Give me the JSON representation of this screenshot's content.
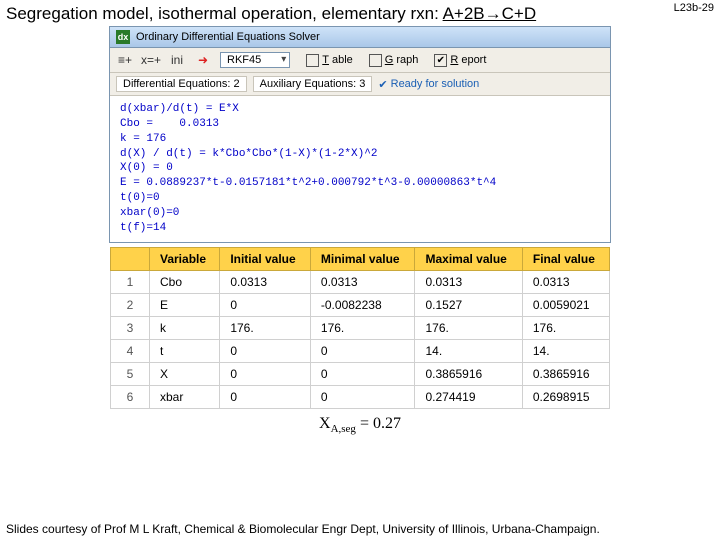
{
  "header": {
    "title_pre": "Segregation model, isothermal operation, elementary rxn: ",
    "title_rxn": "A+2B→C+D",
    "slide_no": "L23b-29"
  },
  "window": {
    "title": "Ordinary Differential Equations Solver"
  },
  "toolbar": {
    "method": "RKF45",
    "opt_table": "Table",
    "opt_graph": "Graph",
    "opt_report": "Report",
    "checked_report": "✔"
  },
  "status": {
    "de_label": "Differential Equations:",
    "de_n": "2",
    "aux_label": "Auxiliary Equations:",
    "aux_n": "3",
    "ready": "Ready for solution"
  },
  "equations": {
    "l1": "d(xbar)/d(t) = E*X",
    "l2": "Cbo =    0.0313",
    "l3": "k = 176",
    "l4": "d(X) / d(t) = k*Cbo*Cbo*(1-X)*(1-2*X)^2",
    "l5": "X(0) = 0",
    "l6": "E = 0.0889237*t-0.0157181*t^2+0.000792*t^3-0.00000863*t^4",
    "l7": "t(0)=0",
    "l8": "xbar(0)=0",
    "l9": "t(f)=14"
  },
  "table": {
    "cols": [
      "Variable",
      "Initial value",
      "Minimal value",
      "Maximal value",
      "Final value"
    ],
    "rows": [
      {
        "n": "1",
        "v": "Cbo",
        "a": "0.0313",
        "b": "0.0313",
        "c": "0.0313",
        "d": "0.0313"
      },
      {
        "n": "2",
        "v": "E",
        "a": "0",
        "b": "-0.0082238",
        "c": "0.1527",
        "d": "0.0059021"
      },
      {
        "n": "3",
        "v": "k",
        "a": "176.",
        "b": "176.",
        "c": "176.",
        "d": "176."
      },
      {
        "n": "4",
        "v": "t",
        "a": "0",
        "b": "0",
        "c": "14.",
        "d": "14."
      },
      {
        "n": "5",
        "v": "X",
        "a": "0",
        "b": "0",
        "c": "0.3865916",
        "d": "0.3865916"
      },
      {
        "n": "6",
        "v": "xbar",
        "a": "0",
        "b": "0",
        "c": "0.274419",
        "d": "0.2698915"
      }
    ]
  },
  "answer": {
    "lhs_main": "X",
    "lhs_sub": "A,seg",
    "rhs": " = 0.27"
  },
  "footer": {
    "text": "Slides courtesy of Prof M L Kraft, Chemical & Biomolecular Engr Dept, University of Illinois, Urbana-Champaign."
  }
}
